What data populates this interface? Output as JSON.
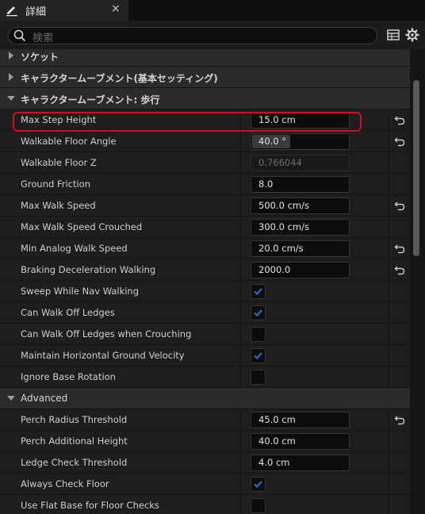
{
  "tab": {
    "title": "詳細",
    "close": "×",
    "icon": "details-pencil-icon"
  },
  "search": {
    "placeholder": "検索"
  },
  "toolbar_icons": [
    "table-view-icon",
    "settings-gear-icon"
  ],
  "categories": {
    "socket": "ソケット",
    "movement_basic": "キャラクタームーブメント(基本セッティング)",
    "movement_walking": "キャラクタームーブメント: 歩行",
    "advanced": "Advanced"
  },
  "walking": {
    "max_step_height": {
      "label": "Max Step Height",
      "value": "15.0 cm"
    },
    "walkable_floor_angle": {
      "label": "Walkable Floor Angle",
      "value": "40.0 °",
      "slider_fraction": 0.4
    },
    "walkable_floor_z": {
      "label": "Walkable Floor Z",
      "value": "0.766044"
    },
    "ground_friction": {
      "label": "Ground Friction",
      "value": "8.0"
    },
    "max_walk_speed": {
      "label": "Max Walk Speed",
      "value": "500.0 cm/s"
    },
    "max_walk_speed_crouched": {
      "label": "Max Walk Speed Crouched",
      "value": "300.0 cm/s"
    },
    "min_analog_walk_speed": {
      "label": "Min Analog Walk Speed",
      "value": "20.0 cm/s"
    },
    "braking_deceleration_walking": {
      "label": "Braking Deceleration Walking",
      "value": "2000.0"
    },
    "sweep_while_nav_walking": {
      "label": "Sweep While Nav Walking",
      "checked": true
    },
    "can_walk_off_ledges": {
      "label": "Can Walk Off Ledges",
      "checked": true
    },
    "can_walk_off_ledges_crouching": {
      "label": "Can Walk Off Ledges when Crouching",
      "checked": false
    },
    "maintain_horizontal_ground_velocity": {
      "label": "Maintain Horizontal Ground Velocity",
      "checked": true
    },
    "ignore_base_rotation": {
      "label": "Ignore Base Rotation",
      "checked": false
    }
  },
  "advanced": {
    "perch_radius_threshold": {
      "label": "Perch Radius Threshold",
      "value": "45.0 cm"
    },
    "perch_additional_height": {
      "label": "Perch Additional Height",
      "value": "40.0 cm"
    },
    "ledge_check_threshold": {
      "label": "Ledge Check Threshold",
      "value": "4.0 cm"
    },
    "always_check_floor": {
      "label": "Always Check Floor",
      "checked": true
    },
    "use_flat_base_for_floor_checks": {
      "label": "Use Flat Base for Floor Checks",
      "checked": false
    }
  },
  "colors": {
    "accent": "#1f6fd1",
    "highlight": "#d0101a",
    "background": "#1e1e1e"
  }
}
